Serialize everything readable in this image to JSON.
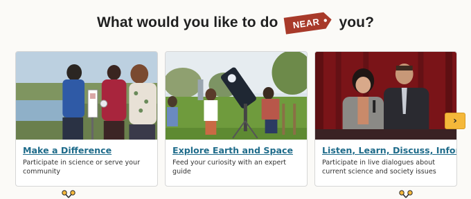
{
  "heading": {
    "before": "What would you like to do",
    "badge": "NEAR",
    "after": "you?"
  },
  "cards": [
    {
      "title": "Make a Difference",
      "description": "Participate in science or serve your community"
    },
    {
      "title": "Explore Earth and Space",
      "description": "Feed your curiosity with an expert guide"
    },
    {
      "title": "Listen, Learn, Discuss, Inform",
      "description": "Participate in live dialogues about current science and society issues"
    }
  ],
  "carousel": {
    "next_label": "›"
  },
  "colors": {
    "badge": "#a83a2a",
    "link": "#1e6b8a",
    "next_button": "#f5b83a"
  }
}
